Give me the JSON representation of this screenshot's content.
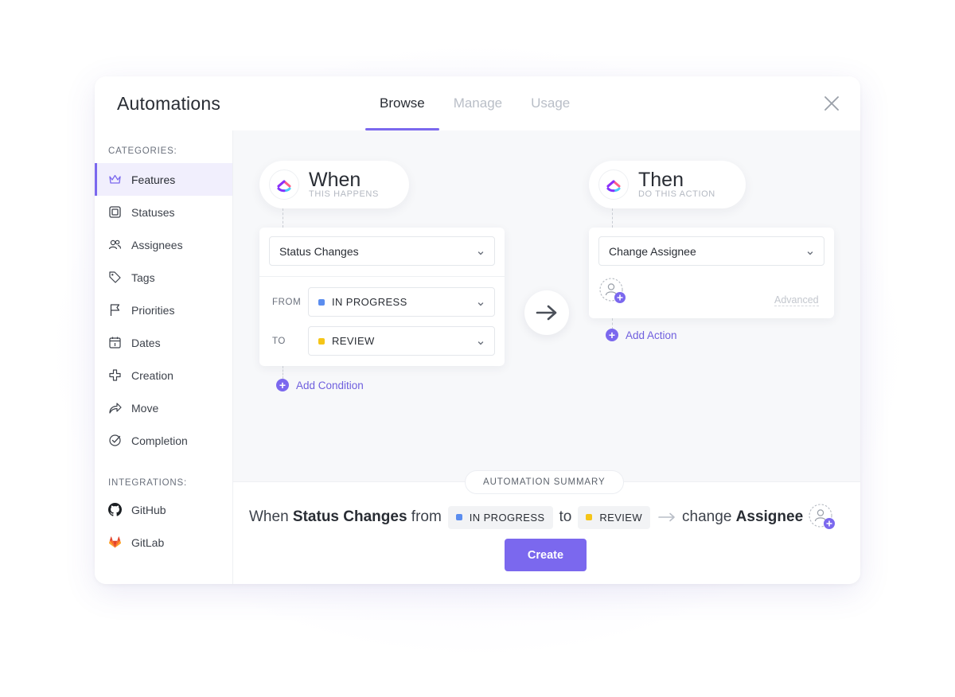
{
  "modal": {
    "title": "Automations"
  },
  "tabs": [
    {
      "label": "Browse",
      "active": true
    },
    {
      "label": "Manage",
      "active": false
    },
    {
      "label": "Usage",
      "active": false
    }
  ],
  "sidebar": {
    "categories_heading": "CATEGORIES:",
    "items": [
      {
        "label": "Features",
        "icon": "crown-icon",
        "active": true
      },
      {
        "label": "Statuses",
        "icon": "square-status-icon"
      },
      {
        "label": "Assignees",
        "icon": "users-icon"
      },
      {
        "label": "Tags",
        "icon": "tags-icon"
      },
      {
        "label": "Priorities",
        "icon": "flag-icon"
      },
      {
        "label": "Dates",
        "icon": "calendar-icon"
      },
      {
        "label": "Creation",
        "icon": "plus-outline-icon"
      },
      {
        "label": "Move",
        "icon": "share-arrow-icon"
      },
      {
        "label": "Completion",
        "icon": "check-circle-icon"
      }
    ],
    "integrations_heading": "INTEGRATIONS:",
    "integrations": [
      {
        "label": "GitHub",
        "icon": "github-icon"
      },
      {
        "label": "GitLab",
        "icon": "gitlab-icon"
      }
    ]
  },
  "trigger": {
    "title": "When",
    "subtitle": "THIS HAPPENS",
    "select": "Status Changes",
    "from_label": "FROM",
    "from_value": "IN PROGRESS",
    "from_color": "#5b8def",
    "to_label": "TO",
    "to_value": "REVIEW",
    "to_color": "#f5c518",
    "add_condition": "Add Condition"
  },
  "action": {
    "title": "Then",
    "subtitle": "DO THIS ACTION",
    "select": "Change Assignee",
    "advanced": "Advanced",
    "add_action": "Add Action"
  },
  "summary": {
    "heading": "AUTOMATION SUMMARY",
    "when": "When",
    "trigger": "Status Changes",
    "from": "from",
    "from_chip": "IN PROGRESS",
    "to": "to",
    "to_chip": "REVIEW",
    "change": "change",
    "field": "Assignee",
    "create_button": "Create"
  },
  "colors": {
    "accent": "#7b68ee",
    "in_progress": "#5b8def",
    "review": "#f5c518"
  }
}
